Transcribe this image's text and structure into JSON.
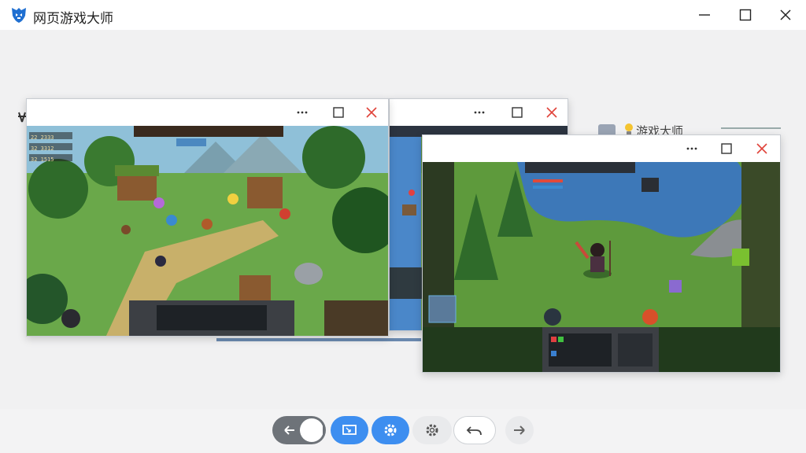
{
  "window": {
    "title": "网页游戏大师",
    "icon": "shield-app-icon",
    "controls": [
      "minimize-icon",
      "maximize-icon",
      "close-icon"
    ]
  },
  "background": {
    "partial_label": "游戏大师"
  },
  "game_windows": [
    {
      "id": "left",
      "controls": [
        "more-icon",
        "maximize-icon",
        "close-icon"
      ],
      "scene": "forest village",
      "hud_stats": [
        "22 2333",
        "32 3312",
        "32 1515"
      ]
    },
    {
      "id": "middle",
      "controls": [
        "more-icon",
        "maximize-icon",
        "close-icon"
      ],
      "scene": "partial"
    },
    {
      "id": "right",
      "controls": [
        "more-icon",
        "maximize-icon",
        "close-icon"
      ],
      "scene": "lakeside forest"
    }
  ],
  "toolbar": {
    "buttons": [
      "back-arrow-icon",
      "circle-toggle",
      "window-screen-icon",
      "settings-active-icon",
      "settings-icon",
      "undo-icon",
      "forward-arrow-icon"
    ]
  },
  "colors": {
    "accent": "#3d8ef0",
    "close_red": "#e0433a",
    "toolbar_gray": "#6e7379"
  }
}
